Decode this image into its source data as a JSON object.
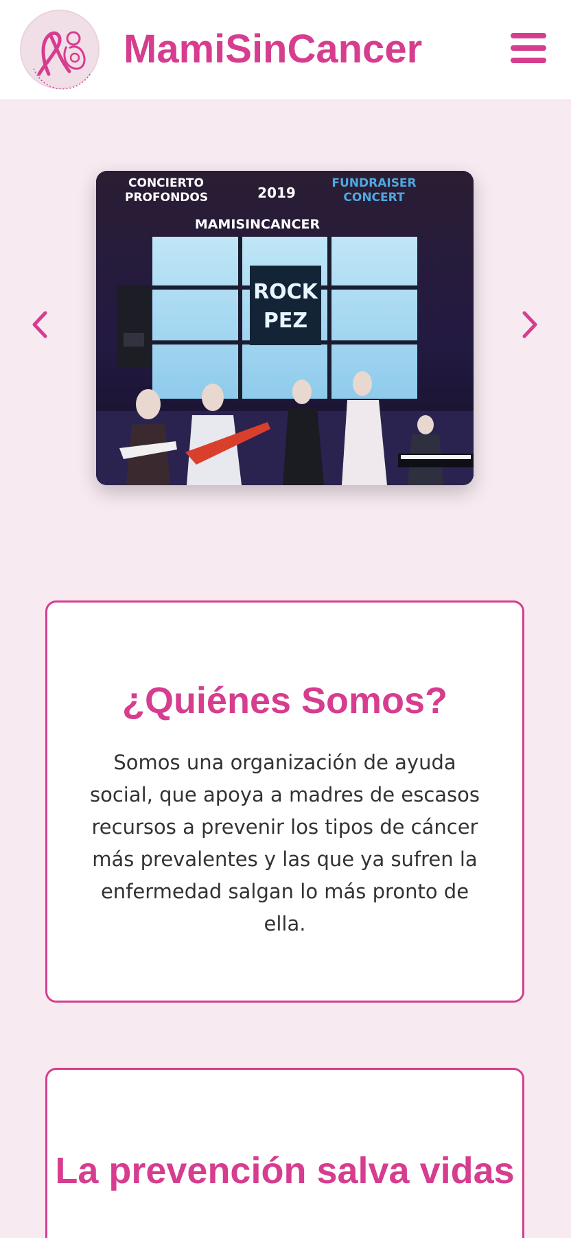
{
  "header": {
    "brand": "MamiSinCancer",
    "logo_icon": "ribbon-mother-logo-icon",
    "menu_icon": "hamburger-menu-icon"
  },
  "carousel": {
    "prev_icon": "chevron-left-icon",
    "next_icon": "chevron-right-icon",
    "slide": {
      "poster_left": "CONCIERTO\nPROFONDOS",
      "poster_year": "2019",
      "poster_right": "FUNDRAISER\nCONCERT",
      "poster_org": "MAMISINCANCER"
    }
  },
  "cards": [
    {
      "title": "¿Quiénes Somos?",
      "text": "Somos una organización de ayuda social, que apoya a madres de escasos recursos a prevenir los tipos de cáncer más prevalentes y las que ya sufren la enfermedad salgan lo más pronto de ella."
    },
    {
      "title": "La prevención salva vidas"
    }
  ],
  "colors": {
    "accent": "#d63d8f",
    "page_background": "#f7eaf1",
    "card_background": "#ffffff",
    "poster_blue": "#4fa8df"
  }
}
